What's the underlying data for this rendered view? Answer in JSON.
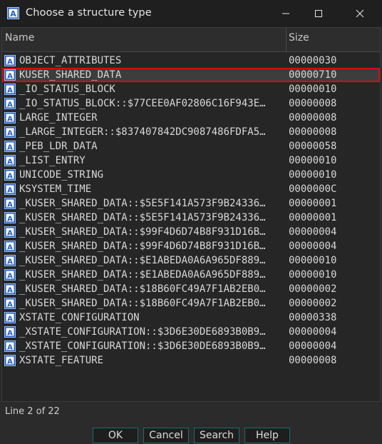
{
  "window": {
    "title": "Choose a structure type"
  },
  "table": {
    "columns": {
      "name": "Name",
      "size": "Size"
    },
    "selected_index": 1,
    "rows": [
      {
        "name": "OBJECT_ATTRIBUTES",
        "size": "00000030"
      },
      {
        "name": "KUSER_SHARED_DATA",
        "size": "00000710"
      },
      {
        "name": "_IO_STATUS_BLOCK",
        "size": "00000010"
      },
      {
        "name": "_IO_STATUS_BLOCK::$77CEE0AF02806C16F943E…",
        "size": "00000008"
      },
      {
        "name": "LARGE_INTEGER",
        "size": "00000008"
      },
      {
        "name": "_LARGE_INTEGER::$837407842DC9087486FDFA5…",
        "size": "00000008"
      },
      {
        "name": "_PEB_LDR_DATA",
        "size": "00000058"
      },
      {
        "name": "_LIST_ENTRY",
        "size": "00000010"
      },
      {
        "name": "UNICODE_STRING",
        "size": "00000010"
      },
      {
        "name": "KSYSTEM_TIME",
        "size": "0000000C"
      },
      {
        "name": "_KUSER_SHARED_DATA::$5E5F141A573F9B24336…",
        "size": "00000001"
      },
      {
        "name": "_KUSER_SHARED_DATA::$5E5F141A573F9B24336…",
        "size": "00000001"
      },
      {
        "name": "_KUSER_SHARED_DATA::$99F4D6D74B8F931D16B…",
        "size": "00000004"
      },
      {
        "name": "_KUSER_SHARED_DATA::$99F4D6D74B8F931D16B…",
        "size": "00000004"
      },
      {
        "name": "_KUSER_SHARED_DATA::$E1ABEDA0A6A965DF889…",
        "size": "00000010"
      },
      {
        "name": "_KUSER_SHARED_DATA::$E1ABEDA0A6A965DF889…",
        "size": "00000010"
      },
      {
        "name": "_KUSER_SHARED_DATA::$18B60FC49A7F1AB2EB0…",
        "size": "00000002"
      },
      {
        "name": "_KUSER_SHARED_DATA::$18B60FC49A7F1AB2EB0…",
        "size": "00000002"
      },
      {
        "name": "XSTATE_CONFIGURATION",
        "size": "00000338"
      },
      {
        "name": "_XSTATE_CONFIGURATION::$3D6E30DE6893B0B9…",
        "size": "00000004"
      },
      {
        "name": "_XSTATE_CONFIGURATION::$3D6E30DE6893B0B9…",
        "size": "00000004"
      },
      {
        "name": "XSTATE_FEATURE",
        "size": "00000008"
      }
    ]
  },
  "status": {
    "text": "Line 2 of 22"
  },
  "buttons": {
    "ok": "OK",
    "cancel": "Cancel",
    "search": "Search",
    "help": "Help"
  },
  "colors": {
    "selection_outline": "#d20f0f",
    "icon_blue": "#1f5fbf"
  },
  "icons": {
    "app": "structure-type-icon",
    "row": "structure-type-icon",
    "minimize": "minimize-icon",
    "maximize": "maximize-icon",
    "close": "close-icon"
  }
}
